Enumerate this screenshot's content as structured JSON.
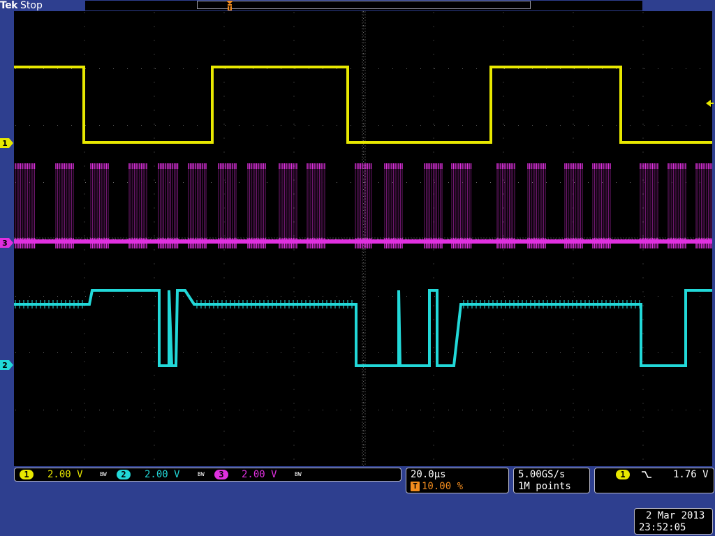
{
  "status_bar": {
    "brand": "Tek",
    "acquisition_state": "Stop"
  },
  "colors": {
    "background": "#2e3f8f",
    "screen": "#000000",
    "ch1": "#e8e800",
    "ch2": "#22d8d8",
    "ch3": "#e030e0",
    "trigger": "#f28c1e"
  },
  "markers": {
    "ch1": "1",
    "ch2": "2",
    "ch3": "3",
    "trigger": "T"
  },
  "vertical": [
    {
      "channel": "1",
      "scale": "2.00 V",
      "bandwidth": "BW"
    },
    {
      "channel": "2",
      "scale": "2.00 V",
      "bandwidth": "BW"
    },
    {
      "channel": "3",
      "scale": "2.00 V",
      "bandwidth": "BW"
    }
  ],
  "horizontal": {
    "scale": "20.0µs",
    "trigger_badge": "T",
    "trigger_position": "10.00 %"
  },
  "acquisition": {
    "sample_rate": "5.00GS/s",
    "record_length": "1M points"
  },
  "trigger": {
    "source": "1",
    "slope": "falling",
    "level": "1.76 V"
  },
  "datetime": {
    "date": "2 Mar 2013",
    "time": "23:52:05"
  }
}
